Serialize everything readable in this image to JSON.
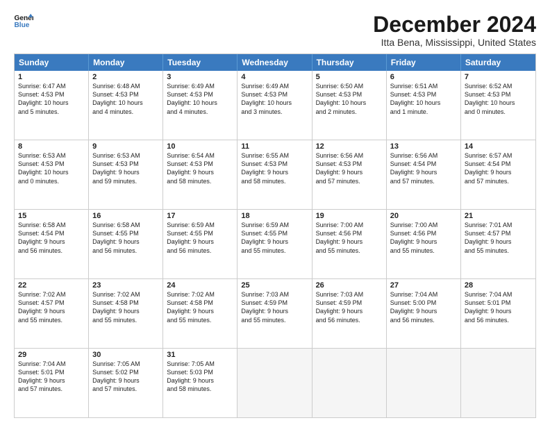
{
  "logo": {
    "line1": "General",
    "line2": "Blue"
  },
  "title": "December 2024",
  "subtitle": "Itta Bena, Mississippi, United States",
  "headers": [
    "Sunday",
    "Monday",
    "Tuesday",
    "Wednesday",
    "Thursday",
    "Friday",
    "Saturday"
  ],
  "weeks": [
    [
      {
        "day": "1",
        "lines": [
          "Sunrise: 6:47 AM",
          "Sunset: 4:53 PM",
          "Daylight: 10 hours",
          "and 5 minutes."
        ]
      },
      {
        "day": "2",
        "lines": [
          "Sunrise: 6:48 AM",
          "Sunset: 4:53 PM",
          "Daylight: 10 hours",
          "and 4 minutes."
        ]
      },
      {
        "day": "3",
        "lines": [
          "Sunrise: 6:49 AM",
          "Sunset: 4:53 PM",
          "Daylight: 10 hours",
          "and 4 minutes."
        ]
      },
      {
        "day": "4",
        "lines": [
          "Sunrise: 6:49 AM",
          "Sunset: 4:53 PM",
          "Daylight: 10 hours",
          "and 3 minutes."
        ]
      },
      {
        "day": "5",
        "lines": [
          "Sunrise: 6:50 AM",
          "Sunset: 4:53 PM",
          "Daylight: 10 hours",
          "and 2 minutes."
        ]
      },
      {
        "day": "6",
        "lines": [
          "Sunrise: 6:51 AM",
          "Sunset: 4:53 PM",
          "Daylight: 10 hours",
          "and 1 minute."
        ]
      },
      {
        "day": "7",
        "lines": [
          "Sunrise: 6:52 AM",
          "Sunset: 4:53 PM",
          "Daylight: 10 hours",
          "and 0 minutes."
        ]
      }
    ],
    [
      {
        "day": "8",
        "lines": [
          "Sunrise: 6:53 AM",
          "Sunset: 4:53 PM",
          "Daylight: 10 hours",
          "and 0 minutes."
        ]
      },
      {
        "day": "9",
        "lines": [
          "Sunrise: 6:53 AM",
          "Sunset: 4:53 PM",
          "Daylight: 9 hours",
          "and 59 minutes."
        ]
      },
      {
        "day": "10",
        "lines": [
          "Sunrise: 6:54 AM",
          "Sunset: 4:53 PM",
          "Daylight: 9 hours",
          "and 58 minutes."
        ]
      },
      {
        "day": "11",
        "lines": [
          "Sunrise: 6:55 AM",
          "Sunset: 4:53 PM",
          "Daylight: 9 hours",
          "and 58 minutes."
        ]
      },
      {
        "day": "12",
        "lines": [
          "Sunrise: 6:56 AM",
          "Sunset: 4:53 PM",
          "Daylight: 9 hours",
          "and 57 minutes."
        ]
      },
      {
        "day": "13",
        "lines": [
          "Sunrise: 6:56 AM",
          "Sunset: 4:54 PM",
          "Daylight: 9 hours",
          "and 57 minutes."
        ]
      },
      {
        "day": "14",
        "lines": [
          "Sunrise: 6:57 AM",
          "Sunset: 4:54 PM",
          "Daylight: 9 hours",
          "and 57 minutes."
        ]
      }
    ],
    [
      {
        "day": "15",
        "lines": [
          "Sunrise: 6:58 AM",
          "Sunset: 4:54 PM",
          "Daylight: 9 hours",
          "and 56 minutes."
        ]
      },
      {
        "day": "16",
        "lines": [
          "Sunrise: 6:58 AM",
          "Sunset: 4:55 PM",
          "Daylight: 9 hours",
          "and 56 minutes."
        ]
      },
      {
        "day": "17",
        "lines": [
          "Sunrise: 6:59 AM",
          "Sunset: 4:55 PM",
          "Daylight: 9 hours",
          "and 56 minutes."
        ]
      },
      {
        "day": "18",
        "lines": [
          "Sunrise: 6:59 AM",
          "Sunset: 4:55 PM",
          "Daylight: 9 hours",
          "and 55 minutes."
        ]
      },
      {
        "day": "19",
        "lines": [
          "Sunrise: 7:00 AM",
          "Sunset: 4:56 PM",
          "Daylight: 9 hours",
          "and 55 minutes."
        ]
      },
      {
        "day": "20",
        "lines": [
          "Sunrise: 7:00 AM",
          "Sunset: 4:56 PM",
          "Daylight: 9 hours",
          "and 55 minutes."
        ]
      },
      {
        "day": "21",
        "lines": [
          "Sunrise: 7:01 AM",
          "Sunset: 4:57 PM",
          "Daylight: 9 hours",
          "and 55 minutes."
        ]
      }
    ],
    [
      {
        "day": "22",
        "lines": [
          "Sunrise: 7:02 AM",
          "Sunset: 4:57 PM",
          "Daylight: 9 hours",
          "and 55 minutes."
        ]
      },
      {
        "day": "23",
        "lines": [
          "Sunrise: 7:02 AM",
          "Sunset: 4:58 PM",
          "Daylight: 9 hours",
          "and 55 minutes."
        ]
      },
      {
        "day": "24",
        "lines": [
          "Sunrise: 7:02 AM",
          "Sunset: 4:58 PM",
          "Daylight: 9 hours",
          "and 55 minutes."
        ]
      },
      {
        "day": "25",
        "lines": [
          "Sunrise: 7:03 AM",
          "Sunset: 4:59 PM",
          "Daylight: 9 hours",
          "and 55 minutes."
        ]
      },
      {
        "day": "26",
        "lines": [
          "Sunrise: 7:03 AM",
          "Sunset: 4:59 PM",
          "Daylight: 9 hours",
          "and 56 minutes."
        ]
      },
      {
        "day": "27",
        "lines": [
          "Sunrise: 7:04 AM",
          "Sunset: 5:00 PM",
          "Daylight: 9 hours",
          "and 56 minutes."
        ]
      },
      {
        "day": "28",
        "lines": [
          "Sunrise: 7:04 AM",
          "Sunset: 5:01 PM",
          "Daylight: 9 hours",
          "and 56 minutes."
        ]
      }
    ],
    [
      {
        "day": "29",
        "lines": [
          "Sunrise: 7:04 AM",
          "Sunset: 5:01 PM",
          "Daylight: 9 hours",
          "and 57 minutes."
        ]
      },
      {
        "day": "30",
        "lines": [
          "Sunrise: 7:05 AM",
          "Sunset: 5:02 PM",
          "Daylight: 9 hours",
          "and 57 minutes."
        ]
      },
      {
        "day": "31",
        "lines": [
          "Sunrise: 7:05 AM",
          "Sunset: 5:03 PM",
          "Daylight: 9 hours",
          "and 58 minutes."
        ]
      },
      {
        "day": "",
        "lines": []
      },
      {
        "day": "",
        "lines": []
      },
      {
        "day": "",
        "lines": []
      },
      {
        "day": "",
        "lines": []
      }
    ]
  ]
}
